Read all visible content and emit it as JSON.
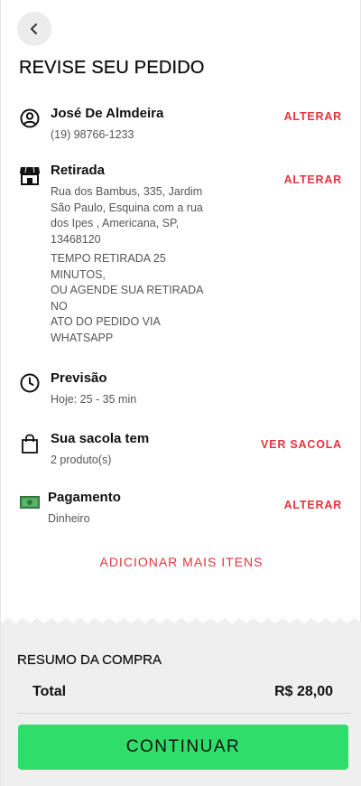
{
  "header": {
    "back_icon": "chevron-left-icon",
    "title": "REVISE SEU PEDIDO"
  },
  "customer": {
    "name": "José De Almdeira",
    "phone": "(19) 98766-1233",
    "action": "ALTERAR",
    "icon": "user-circle-icon"
  },
  "pickup": {
    "label": "Retirada",
    "address_lines": [
      "Rua dos Bambus, 335, Jardim",
      "São Paulo, Esquina com a rua",
      "dos Ipes , Americana, SP,",
      "13468120"
    ],
    "note_lines": [
      "TEMPO RETIRADA 25",
      "MINUTOS,",
      "OU AGENDE SUA RETIRADA",
      "NO",
      "ATO DO PEDIDO VIA",
      "WHATSAPP"
    ],
    "action": "ALTERAR",
    "icon": "store-icon"
  },
  "forecast": {
    "label": "Previsão",
    "value": "Hoje: 25 - 35 min",
    "icon": "clock-icon"
  },
  "bag": {
    "label": "Sua sacola tem",
    "count": "2 produto(s)",
    "action": "VER SACOLA",
    "icon": "shopping-bag-icon"
  },
  "payment": {
    "label": "Pagamento",
    "method": "Dinheiro",
    "action": "ALTERAR",
    "icon": "cash-icon"
  },
  "add_more": "ADICIONAR MAIS ITENS",
  "summary": {
    "title": "RESUMO DA COMPRA",
    "total_label": "Total",
    "total_value": "R$ 28,00"
  },
  "cta": "CONTINUAR",
  "colors": {
    "accent": "#e8323a",
    "cta": "#2fde6a",
    "summary_bg": "#efefef"
  }
}
